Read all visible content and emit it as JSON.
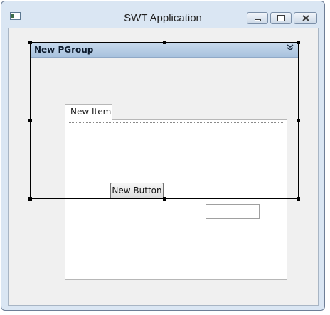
{
  "window": {
    "title": "SWT Application",
    "controls": [
      "minimize",
      "maximize",
      "close"
    ]
  },
  "pgroup": {
    "title": "New PGroup",
    "toggle_icon": "double-chevron-down-icon",
    "toggle_glyph": "»"
  },
  "tab_folder": {
    "tabs": [
      {
        "label": "New Item",
        "selected": true
      }
    ]
  },
  "button": {
    "label": "New Button"
  },
  "text_field": {
    "value": "",
    "placeholder": ""
  },
  "colors": {
    "frame": "#dae6f3",
    "client": "#f0f0f0",
    "pgroup_header": "#b8cde5",
    "selection": "#000000"
  }
}
